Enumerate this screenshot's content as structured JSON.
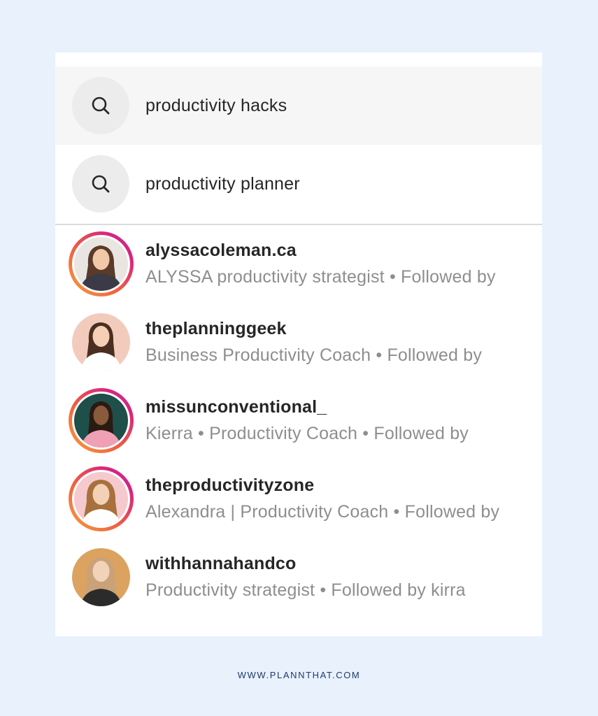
{
  "search_suggestions": [
    {
      "icon": "search-icon",
      "text": "productivity hacks"
    },
    {
      "icon": "search-icon",
      "text": "productivity planner"
    }
  ],
  "accounts": [
    {
      "username": "alyssacoleman.ca",
      "subtitle": "ALYSSA productivity strategist • Followed by",
      "story_ring": true,
      "avatar_bg": "#e9e6e2",
      "hair": "#5a3a28",
      "shirt": "#3b3b48"
    },
    {
      "username": "theplanninggeek",
      "subtitle": "Business Productivity Coach • Followed by",
      "story_ring": false,
      "avatar_bg": "#f2cbbd",
      "hair": "#4a2e1f",
      "shirt": "#ffffff"
    },
    {
      "username": "missunconventional_",
      "subtitle": "Kierra • Productivity Coach • Followed by",
      "story_ring": true,
      "avatar_bg": "#1f4f4a",
      "hair": "#2a1a12",
      "shirt": "#f0a0b4"
    },
    {
      "username": "theproductivityzone",
      "subtitle": "Alexandra | Productivity Coach • Followed by",
      "story_ring": true,
      "avatar_bg": "#f6c9cf",
      "hair": "#a8703c",
      "shirt": "#ffffff"
    },
    {
      "username": "withhannahandco",
      "subtitle": "Productivity strategist • Followed by kirra",
      "story_ring": false,
      "avatar_bg": "#dba35f",
      "hair": "#c9a27a",
      "shirt": "#2b2b2b"
    }
  ],
  "footer": {
    "text": "WWW.PLANNTHAT.COM"
  },
  "colors": {
    "background": "#e8f1fc",
    "username": "#262626",
    "subtitle": "#8e8e8e",
    "footer": "#1f3a6b"
  }
}
